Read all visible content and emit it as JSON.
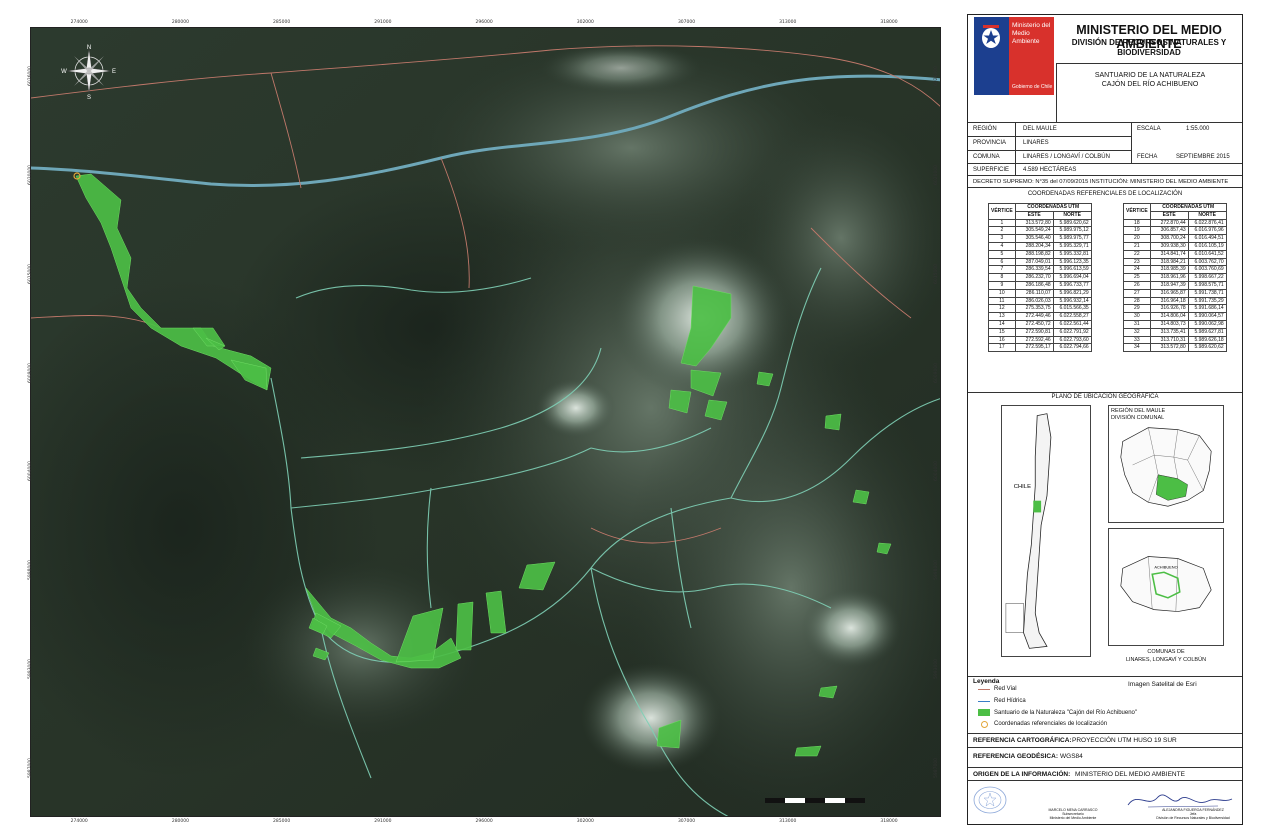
{
  "map": {
    "top_ticks": [
      "274000",
      "280000",
      "285000",
      "291000",
      "296000",
      "302000",
      "307000",
      "313000",
      "318000"
    ],
    "bottom_ticks": [
      "274000",
      "280000",
      "285000",
      "291000",
      "296000",
      "302000",
      "307000",
      "313000",
      "318000"
    ],
    "left_ticks": [
      "6026000",
      "6020000",
      "6015000",
      "6009000",
      "6004000",
      "5998000",
      "5993000",
      "5987000"
    ],
    "right_ticks": [
      "6026000",
      "6020000",
      "6015000",
      "6009000",
      "6004000",
      "5998000",
      "5993000",
      "5987000"
    ],
    "compass": {
      "n": "N",
      "s": "S",
      "e": "E",
      "w": "W"
    },
    "colors": {
      "imagery": "#243026",
      "sanctuary": "#4cbe45",
      "rivers": "#7fd0b6",
      "roads": "#c0786a",
      "snow": "#d9e4dc"
    }
  },
  "header": {
    "logo_text": "Ministerio del Medio Ambiente",
    "logo_gov": "Gobierno de Chile",
    "ministry": "MINISTERIO DEL MEDIO AMBIENTE",
    "division": "DIVISIÓN DE RECURSOS NATURALES Y BIODIVERSIDAD",
    "sanctuary_line1": "SANTUARIO DE LA NATURALEZA",
    "sanctuary_line2": "CAJÓN DEL RÍO ACHIBUENO"
  },
  "info": {
    "region_label": "REGIÓN",
    "region_value": "DEL MAULE",
    "provincia_label": "PROVINCIA",
    "provincia_value": "LINARES",
    "comuna_label": "COMUNA",
    "comuna_value": "LINARES / LONGAVÍ / COLBÚN",
    "escala_label": "ESCALA",
    "escala_value": "1:55.000",
    "fecha_label": "FECHA",
    "fecha_value": "SEPTIEMBRE 2015",
    "superficie_label": "SUPERFICIE",
    "superficie_value": "4.589 HECTÁREAS",
    "decreto": "DECRETO SUPREMO: N°35 del 07/09/2015  INSTITUCIÓN: MINISTERIO DEL MEDIO AMBIENTE"
  },
  "coords": {
    "title": "COORDENADAS REFERENCIALES DE LOCALIZACIÓN",
    "h_vertice": "VÉRTICE",
    "h_utm": "COORDENADAS UTM",
    "h_este": "ESTE",
    "h_norte": "NORTE",
    "left": [
      [
        "1",
        "313.572,80",
        "5.989.620,62"
      ],
      [
        "2",
        "305.549,24",
        "5.989.975,12"
      ],
      [
        "3",
        "305.546,40",
        "5.989.975,77"
      ],
      [
        "4",
        "288.204,34",
        "5.995.329,71"
      ],
      [
        "5",
        "288.198,82",
        "5.995.332,81"
      ],
      [
        "6",
        "287.049,01",
        "5.996.123,35"
      ],
      [
        "7",
        "286.339,54",
        "5.996.613,59"
      ],
      [
        "8",
        "286.232,70",
        "5.996.694,04"
      ],
      [
        "9",
        "286.186,48",
        "5.996.733,77"
      ],
      [
        "10",
        "286.110,07",
        "5.996.821,29"
      ],
      [
        "11",
        "286.026,03",
        "5.996.932,14"
      ],
      [
        "12",
        "275.353,75",
        "6.015.566,35"
      ],
      [
        "13",
        "272.449,46",
        "6.022.558,27"
      ],
      [
        "14",
        "272.450,72",
        "6.022.561,44"
      ],
      [
        "15",
        "272.590,81",
        "6.022.791,92"
      ],
      [
        "16",
        "272.592,46",
        "6.022.793,60"
      ],
      [
        "17",
        "272.595,17",
        "6.022.794,66"
      ]
    ],
    "right": [
      [
        "18",
        "272.870,44",
        "6.022.876,41"
      ],
      [
        "19",
        "306.857,43",
        "6.016.976,96"
      ],
      [
        "20",
        "308.700,24",
        "6.016.494,51"
      ],
      [
        "21",
        "309.938,30",
        "6.016.105,19"
      ],
      [
        "22",
        "314.841,74",
        "6.010.641,52"
      ],
      [
        "23",
        "318.984,21",
        "6.003.762,70"
      ],
      [
        "24",
        "318.985,39",
        "6.003.760,69"
      ],
      [
        "25",
        "318.961,96",
        "5.998.667,22"
      ],
      [
        "26",
        "318.947,39",
        "5.998.575,71"
      ],
      [
        "27",
        "316.965,87",
        "5.991.738,71"
      ],
      [
        "28",
        "316.964,18",
        "5.991.735,29"
      ],
      [
        "29",
        "316.926,78",
        "5.991.686,14"
      ],
      [
        "30",
        "314.806,04",
        "5.990.064,57"
      ],
      [
        "31",
        "314.803,73",
        "5.990.062,98"
      ],
      [
        "32",
        "313.735,41",
        "5.989.627,81"
      ],
      [
        "33",
        "313.710,31",
        "5.989.626,18"
      ],
      [
        "34",
        "313.572,80",
        "5.989.620,62"
      ]
    ]
  },
  "plano": {
    "title": "PLANO DE UBICACIÓN GEOGRÁFICA",
    "chile_label": "CHILE",
    "region_title_1": "REGIÓN DEL MAULE",
    "region_title_2": "DIVISIÓN COMUNAL",
    "comunas_inner": "ACHIBUENO",
    "comunas_title_1": "COMUNAS DE",
    "comunas_title_2": "LINARES, LONGAVÍ Y COLBÚN"
  },
  "legend": {
    "title": "Leyenda",
    "imagery": "Imagen Satelital de Esri",
    "red_vial": "Red Vial",
    "red_hidrica": "Red Hídrica",
    "santuario": "Santuario de la Naturaleza \"Cajón del Río Achibueno\"",
    "coordenadas": "Coordenadas referenciales de localización"
  },
  "refs": {
    "carto_label": "REFERENCIA CARTOGRÁFICA:",
    "carto_value": "PROYECCIÓN UTM HUSO 19 SUR",
    "geo_label": "REFERENCIA GEODÉSICA:",
    "geo_value": "WGS84",
    "origen_label": "ORIGEN DE LA INFORMACIÓN:",
    "origen_value": "MINISTERIO DEL MEDIO AMBIENTE"
  },
  "signatures": {
    "left_name": "MARCELO MENA CARRASCO",
    "left_role": "Subsecretario",
    "left_org": "Ministerio del Medio Ambiente",
    "right_name": "ALEJANDRA FIGUEROA FERNÁNDEZ",
    "right_role": "Jefa",
    "right_org": "División de Recursos Naturales y Biodiversidad"
  }
}
